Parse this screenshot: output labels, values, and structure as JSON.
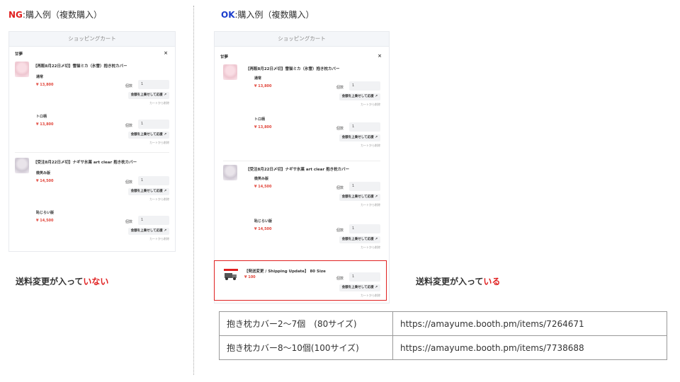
{
  "ng": {
    "tag": "NG",
    "heading_rest": ":購入例（複数購入）",
    "caption_normal": "送料変更が入って",
    "caption_red": "いない"
  },
  "ok": {
    "tag": "OK",
    "heading_rest": ":購入例（複数購入）",
    "caption_normal": "送料変更が入って",
    "caption_red": "いる"
  },
  "colors": {
    "ng_tag": "#e02020",
    "ok_tag": "#1a3ccc",
    "highlight": "#e02020",
    "price": "#e1453a"
  },
  "cart": {
    "header": "ショッピングカート",
    "shop_name": "甘夢",
    "close": "×",
    "qty_label": "個数",
    "upsell_label": "金額を上乗せして応援 ↗",
    "remove_label": "カートから削除",
    "products": [
      {
        "title": "【再販8月22日〆切】雪猫ミカ（氷雪）抱き枕カバー",
        "thumb": "pink",
        "variants": [
          {
            "name": "通常",
            "price": "¥ 13,800",
            "qty": "1"
          },
          {
            "name": "トロ柄",
            "price": "¥ 13,800",
            "qty": "1"
          }
        ]
      },
      {
        "title": "【受注8月22日〆切】ナギサ氷菓 art clear 抱き枕カバー",
        "thumb": "gray",
        "variants": [
          {
            "name": "微笑み版",
            "price": "¥ 14,500",
            "qty": "1"
          },
          {
            "name": "恥じらい版",
            "price": "¥ 14,500",
            "qty": "1"
          }
        ]
      }
    ],
    "shipping": {
      "title": "【発送変更 / Shipping Update】 80 Size",
      "price": "¥ 100",
      "qty": "1",
      "thumb_icon": "truck-icon"
    }
  },
  "links_table": [
    {
      "label": "抱き枕カバー2〜7個　(80サイズ)",
      "url": "https://amayume.booth.pm/items/7264671"
    },
    {
      "label": "抱き枕カバー8〜10個(100サイズ)",
      "url": "https://amayume.booth.pm/items/7738688"
    }
  ]
}
